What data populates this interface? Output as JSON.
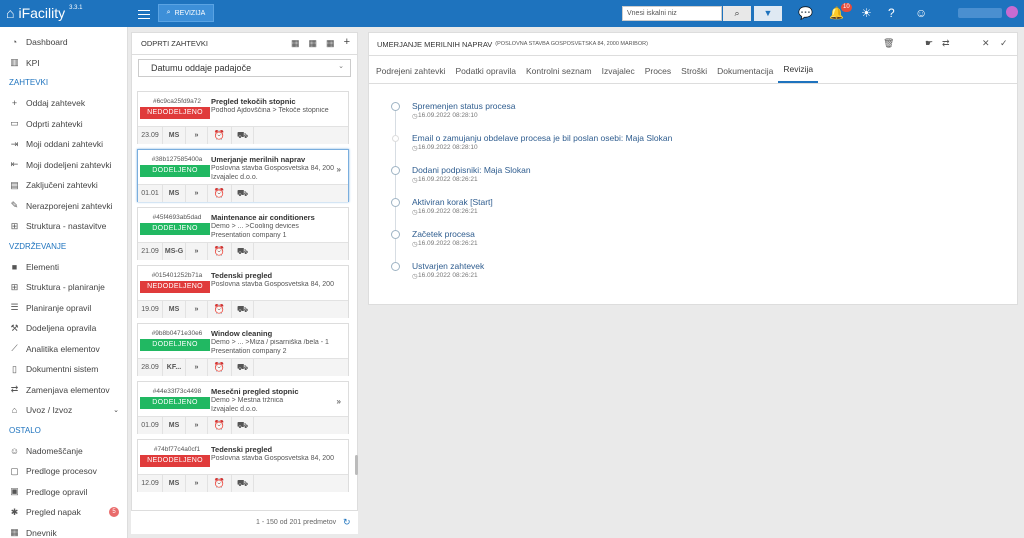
{
  "app": {
    "name": "iFacility",
    "version": "3.3.1",
    "revizija_label": "REVIZIJA",
    "search_placeholder": "Vnesi iskalni niz",
    "notif_count": "10"
  },
  "sidebar": {
    "items_top": [
      {
        "label": "Dashboard",
        "icon": "gauge-icon"
      },
      {
        "label": "KPI",
        "icon": "chart-icon"
      }
    ],
    "sec1": "ZAHTEVKI",
    "items1": [
      {
        "label": "Oddaj zahtevek",
        "icon": "plus-icon"
      },
      {
        "label": "Odprti zahtevki",
        "icon": "inbox-icon"
      },
      {
        "label": "Moji oddani zahtevki",
        "icon": "signin-icon"
      },
      {
        "label": "Moji dodeljeni zahtevki",
        "icon": "signout-icon"
      },
      {
        "label": "Zaključeni zahtevki",
        "icon": "clipboard-icon"
      },
      {
        "label": "Nerazporejeni zahtevki",
        "icon": "edit-icon"
      },
      {
        "label": "Struktura - nastavitve",
        "icon": "tree-icon"
      }
    ],
    "sec2": "VZDRŽEVANJE",
    "items2": [
      {
        "label": "Elementi",
        "icon": "square-icon"
      },
      {
        "label": "Struktura - planiranje",
        "icon": "tree-icon"
      },
      {
        "label": "Planiranje opravil",
        "icon": "list-icon"
      },
      {
        "label": "Dodeljena opravila",
        "icon": "wrench-icon"
      },
      {
        "label": "Analitika elementov",
        "icon": "linechart-icon"
      },
      {
        "label": "Dokumentni sistem",
        "icon": "doc-icon"
      },
      {
        "label": "Zamenjava elementov",
        "icon": "exchange-icon"
      },
      {
        "label": "Uvoz / Izvoz",
        "icon": "bank-icon"
      }
    ],
    "sec3": "OSTALO",
    "items3": [
      {
        "label": "Nadomeščanje",
        "icon": "users-icon"
      },
      {
        "label": "Predloge procesov",
        "icon": "template-icon"
      },
      {
        "label": "Predloge opravil",
        "icon": "template-icon"
      },
      {
        "label": "Pregled napak",
        "icon": "bug-icon",
        "badge": "5"
      },
      {
        "label": "Dnevnik",
        "icon": "table-icon"
      }
    ]
  },
  "middle": {
    "title": "ODPRTI ZAHTEVKI",
    "sort": "Datumu oddaje padajoče",
    "footer": "1 - 150 od 201 predmetov",
    "cards": [
      {
        "id": "#6c9ca25fd9a72",
        "status": "NEDODELJENO",
        "color": "red",
        "title": "Pregled tekočih stopnic",
        "l1": "Podhod Ajdovščina > Tekoče stopnice",
        "l2": "",
        "date": "23.09",
        "ms": "MS",
        "exp": ""
      },
      {
        "id": "#38b127585400a",
        "status": "DODELJENO",
        "color": "green",
        "title": "Umerjanje merilnih naprav",
        "l1": "Poslovna stavba Gosposvetska 84, 200",
        "l2": "Izvajalec d.o.o.",
        "date": "01.01",
        "ms": "MS",
        "exp": "»"
      },
      {
        "id": "#45f4693ab5dad",
        "status": "DODELJENO",
        "color": "green",
        "title": "Maintenance air conditioners",
        "l1": "Demo > ... >Cooling devices",
        "l2": "Presentation company 1",
        "date": "21.09",
        "ms": "MS-G",
        "exp": ""
      },
      {
        "id": "#015401252b71a",
        "status": "NEDODELJENO",
        "color": "red",
        "title": "Tedenski pregled",
        "l1": "Poslovna stavba Gosposvetska 84, 200",
        "l2": "",
        "date": "19.09",
        "ms": "MS",
        "exp": ""
      },
      {
        "id": "#9b8b0471e30e6",
        "status": "DODELJENO",
        "color": "green",
        "title": "Window cleaning",
        "l1": "Demo > ... >Miza / pisarniška /bela - 1",
        "l2": "Presentation company 2",
        "date": "28.09",
        "ms": "KF...",
        "exp": ""
      },
      {
        "id": "#44e33f73c4498",
        "status": "DODELJENO",
        "color": "green",
        "title": "Mesečni pregled stopnic",
        "l1": "Demo > Mestna tržnica",
        "l2": "Izvajalec d.o.o.",
        "date": "01.09",
        "ms": "MS",
        "exp": "»"
      },
      {
        "id": "#74bf77c4a0cf1",
        "status": "NEDODELJENO",
        "color": "red",
        "title": "Tedenski pregled",
        "l1": "Poslovna stavba Gosposvetska 84, 200",
        "l2": "",
        "date": "12.09",
        "ms": "MS",
        "exp": ""
      }
    ]
  },
  "detail": {
    "title": "UMERJANJE MERILNIH NAPRAV",
    "subtitle": "(POSLOVNA STAVBA GOSPOSVETSKA 84, 2000 MARIBOR)",
    "tabs": [
      "Podrejeni zahtevki",
      "Podatki opravila",
      "Kontrolni seznam",
      "Izvajalec",
      "Proces",
      "Stroški",
      "Dokumentacija",
      "Revizija"
    ],
    "active_tab": "Revizija",
    "events": [
      {
        "text": "Spremenjen status procesa",
        "date": "16.09.2022 08:28:10"
      },
      {
        "text": "Email o zamujanju obdelave procesa je bil poslan osebi: Maja Slokan",
        "date": "16.09.2022 08:28:10"
      },
      {
        "text": "Dodani podpisniki: Maja Slokan",
        "date": "16.09.2022 08:26:21"
      },
      {
        "text": "Aktiviran korak [Start]",
        "date": "16.09.2022 08:26:21"
      },
      {
        "text": "Začetek procesa",
        "date": "16.09.2022 08:26:21"
      },
      {
        "text": "Ustvarjen zahtevek",
        "date": "16.09.2022 08:26:21"
      }
    ]
  }
}
